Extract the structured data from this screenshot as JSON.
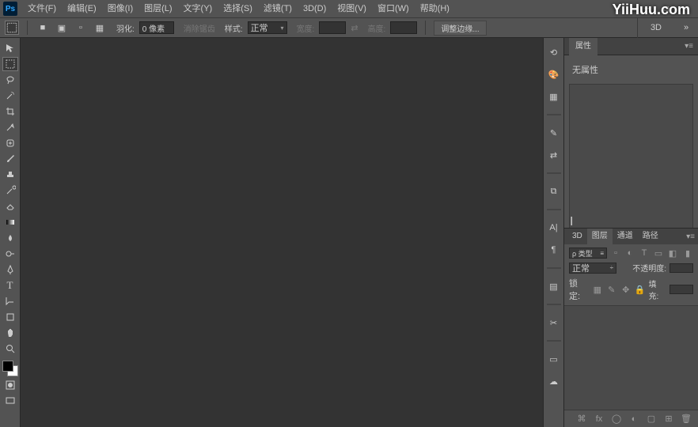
{
  "menu": {
    "items": [
      "文件(F)",
      "编辑(E)",
      "图像(I)",
      "图层(L)",
      "文字(Y)",
      "选择(S)",
      "滤镜(T)",
      "3D(D)",
      "视图(V)",
      "窗口(W)",
      "帮助(H)"
    ]
  },
  "optbar": {
    "feather_label": "羽化:",
    "feather_val": "0 像素",
    "antialias": "消除锯齿",
    "style_label": "样式:",
    "style_val": "正常",
    "width_label": "宽度:",
    "height_label": "高度:",
    "refine": "调整边缘...",
    "mode_3d": "3D"
  },
  "tools": [
    "move",
    "marquee",
    "lasso",
    "wand",
    "crop",
    "eyedrop",
    "heal",
    "brush",
    "stamp",
    "history",
    "eraser",
    "grad",
    "blur",
    "dodge",
    "pen",
    "type",
    "path",
    "shape",
    "hand",
    "zoom"
  ],
  "dock_icons": [
    "history",
    "color",
    "swatches",
    "styles",
    "adjust",
    "mask",
    "brush-preset",
    "clone",
    "char",
    "para",
    "nav",
    "tool-preset",
    "layer-comp",
    "cc"
  ],
  "panels": {
    "props": {
      "tab": "属性",
      "noprops": "无属性"
    },
    "layers": {
      "tabs": [
        "3D",
        "图层",
        "通道",
        "路径"
      ],
      "filter": "ρ 类型",
      "blend": "正常",
      "opacity_label": "不透明度:",
      "lock_label": "锁定:",
      "fill_label": "填充:",
      "lock_icons": [
        "img",
        "pos",
        "all"
      ]
    }
  },
  "watermark": "YiiHuu.com"
}
